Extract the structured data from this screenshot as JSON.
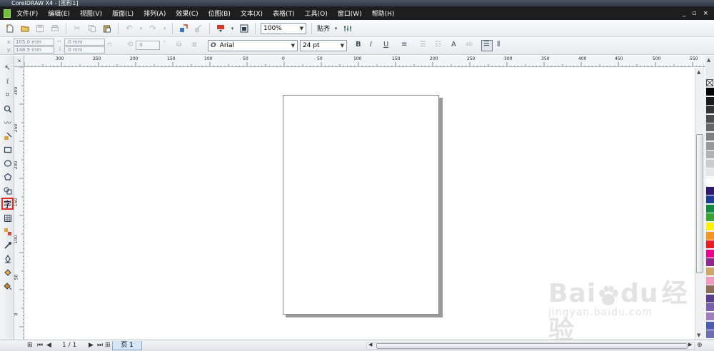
{
  "window": {
    "title": "CorelDRAW X4 - [图形1]",
    "controls": [
      "_",
      "▫",
      "×"
    ]
  },
  "menu": [
    {
      "label": "文件(F)"
    },
    {
      "label": "编辑(E)"
    },
    {
      "label": "视图(V)"
    },
    {
      "label": "版面(L)"
    },
    {
      "label": "排列(A)"
    },
    {
      "label": "效果(C)"
    },
    {
      "label": "位图(B)"
    },
    {
      "label": "文本(X)"
    },
    {
      "label": "表格(T)"
    },
    {
      "label": "工具(O)"
    },
    {
      "label": "窗口(W)"
    },
    {
      "label": "帮助(H)"
    }
  ],
  "toolbar": {
    "zoom": "100%",
    "snap_label": "贴齐"
  },
  "property_bar": {
    "x": "105.0 mm",
    "y": "148.5 mm",
    "w": ".0 mm",
    "h": ".0 mm",
    "x_label": "x:",
    "y_label": "y:",
    "angle": ".0",
    "font_name": "Arial",
    "font_icon": "O",
    "font_size": "24 pt"
  },
  "ruler": {
    "corner_icon": "⇲",
    "top_labels": [
      "300",
      "250",
      "200",
      "150",
      "100",
      "50",
      "0",
      "50",
      "100",
      "150",
      "200",
      "250",
      "300",
      "350",
      "400",
      "450",
      "500",
      "550"
    ],
    "left_labels": [
      "300",
      "250",
      "200",
      "150",
      "100",
      "50",
      "0"
    ]
  },
  "status": {
    "page_count": "1 / 1",
    "page_tab": "页 1"
  },
  "palette": {
    "colors": [
      "#000000",
      "#1a1a1a",
      "#333333",
      "#4d4d4d",
      "#666666",
      "#808080",
      "#999999",
      "#b3b3b3",
      "#cccccc",
      "#e6e6e6",
      "#ffffff",
      "#2e1a6e",
      "#1f3c99",
      "#138a44",
      "#3aa532",
      "#fff200",
      "#f7941d",
      "#ed1c24",
      "#ec008c",
      "#92278f",
      "#d2a56b",
      "#f49ac1",
      "#8e6e59",
      "#5a3f8f",
      "#7b61ad",
      "#a07fc0",
      "#4d5cae",
      "#6d6fb2",
      "#524b8b",
      "#3d3a6e"
    ]
  },
  "watermark": {
    "brand": "Bai",
    "brand2": "du",
    "cn": "经验",
    "url": "jingyan.baidu.com"
  }
}
